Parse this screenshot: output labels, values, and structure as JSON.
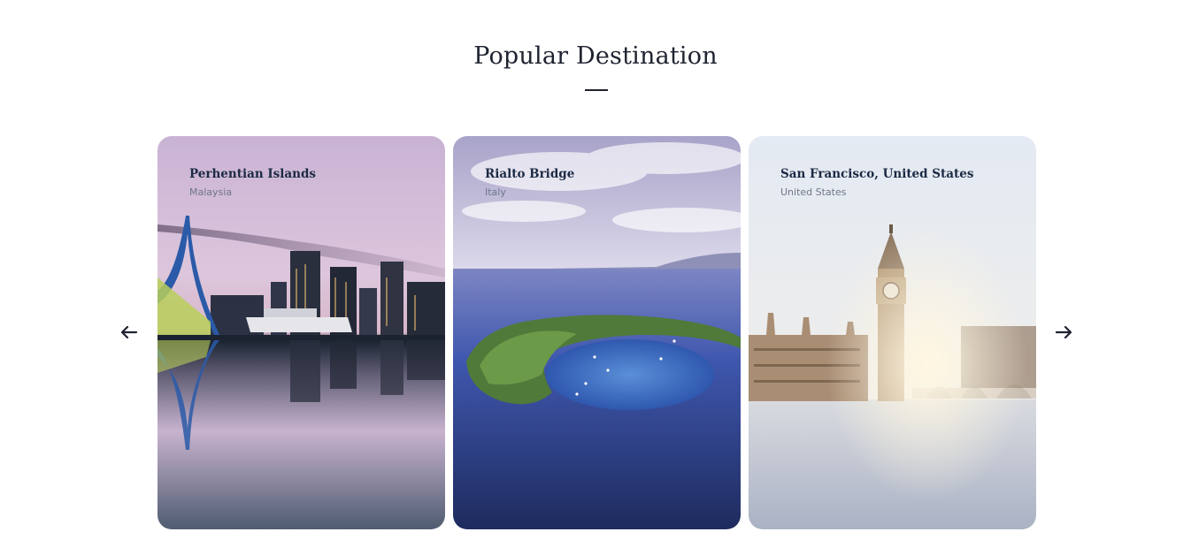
{
  "section": {
    "title": "Popular Destination"
  },
  "carousel": {
    "prev_icon": "arrow-left-icon",
    "next_icon": "arrow-right-icon",
    "cards": [
      {
        "title": "Perhentian Islands",
        "subtitle": "Malaysia"
      },
      {
        "title": "Rialto Bridge",
        "subtitle": "Italy"
      },
      {
        "title": "San Francisco, United States",
        "subtitle": "United States"
      }
    ]
  },
  "colors": {
    "heading": "#1f2330",
    "card_title": "#1c2a44",
    "card_subtitle": "#6f7688"
  }
}
